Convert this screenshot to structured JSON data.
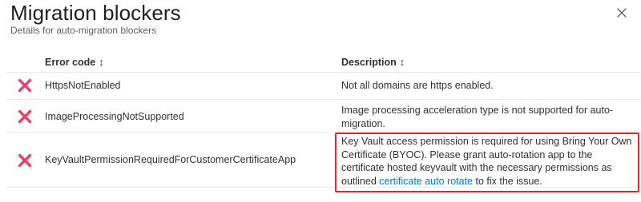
{
  "header": {
    "title": "Migration blockers",
    "subtitle": "Details for auto-migration blockers",
    "close_icon": "close-icon"
  },
  "table": {
    "columns": [
      {
        "label": "Error code",
        "sort_glyph": "↕"
      },
      {
        "label": "Description",
        "sort_glyph": "↕"
      }
    ],
    "rows": [
      {
        "status_icon": "error-x-icon",
        "error_code": "HttpsNotEnabled",
        "description": "Not all domains are https enabled."
      },
      {
        "status_icon": "error-x-icon",
        "error_code": "ImageProcessingNotSupported",
        "description": "Image processing acceleration type is not supported for auto-migration."
      },
      {
        "status_icon": "error-x-icon",
        "error_code": "KeyVaultPermissionRequiredForCustomerCertificateApp",
        "description_before_link": "Key Vault access permission is required for using Bring Your Own Certificate (BYOC). Please grant auto-rotation app to the certificate hosted keyvault with the necessary permissions as outlined ",
        "description_link": "certificate auto rotate",
        "description_after_link": " to fix the issue."
      }
    ]
  },
  "colors": {
    "error_icon": "#e8416b",
    "link": "#0078d4",
    "highlight_border": "#e02828",
    "divider": "#edebe9"
  }
}
